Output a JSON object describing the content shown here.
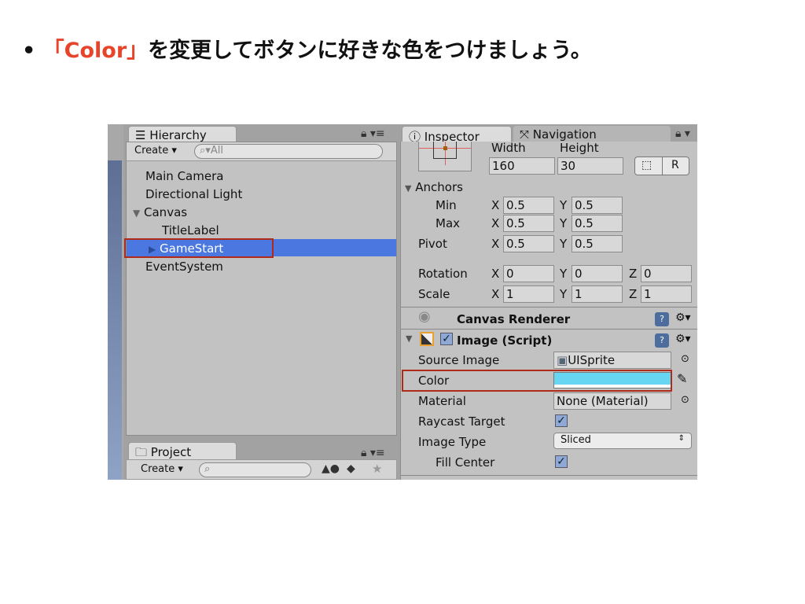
{
  "slide": {
    "bullet": "•",
    "highlight": "「Color」",
    "rest": "を変更してボタンに好きな色をつけましょう。"
  },
  "hierarchy": {
    "tab": "Hierarchy",
    "create": "Create",
    "search_placeholder": "All",
    "items": [
      "Main Camera",
      "Directional Light",
      "Canvas",
      "TitleLabel",
      "GameStart",
      "EventSystem"
    ],
    "selected": "GameStart"
  },
  "project": {
    "tab": "Project",
    "create": "Create"
  },
  "inspector": {
    "tab": "Inspector",
    "nav_tab": "Navigation",
    "width_label": "Width",
    "height_label": "Height",
    "width": "160",
    "height": "30",
    "r_button": "R",
    "anchors": "Anchors",
    "min": "Min",
    "max": "Max",
    "pivot": "Pivot",
    "rotation": "Rotation",
    "scale": "Scale",
    "x": "X",
    "y": "Y",
    "z": "Z",
    "min_x": "0.5",
    "min_y": "0.5",
    "max_x": "0.5",
    "max_y": "0.5",
    "pivot_x": "0.5",
    "pivot_y": "0.5",
    "rot_x": "0",
    "rot_y": "0",
    "rot_z": "0",
    "scale_x": "1",
    "scale_y": "1",
    "scale_z": "1",
    "canvas_renderer": "Canvas Renderer",
    "image_script": "Image (Script)",
    "source_image_label": "Source Image",
    "source_image": "UISprite",
    "color_label": "Color",
    "color_value": "#66d6f2",
    "material_label": "Material",
    "material": "None (Material)",
    "raycast_label": "Raycast Target",
    "image_type_label": "Image Type",
    "image_type": "Sliced",
    "fill_center_label": "Fill Center"
  },
  "colors": {
    "highlight": "#e8442a",
    "selection": "#4a78e0",
    "annotation_box": "#b02a1c"
  }
}
